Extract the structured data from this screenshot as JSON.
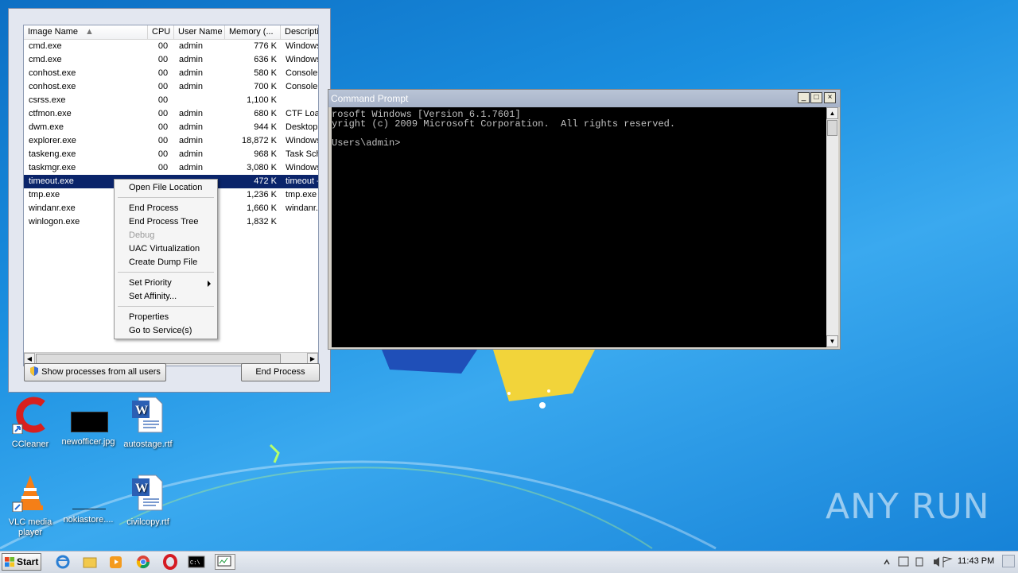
{
  "colors": {
    "selection": "#0a246a",
    "desktop": "#1a8fe0",
    "console_bg": "#000000",
    "console_fg": "#c0c0c0"
  },
  "taskmgr": {
    "columns": [
      "Image Name",
      "CPU",
      "User Name",
      "Memory (...",
      "Descripti"
    ],
    "processes": [
      {
        "name": "cmd.exe",
        "cpu": "00",
        "user": "admin",
        "mem": "776 K",
        "desc": "Windows"
      },
      {
        "name": "cmd.exe",
        "cpu": "00",
        "user": "admin",
        "mem": "636 K",
        "desc": "Windows"
      },
      {
        "name": "conhost.exe",
        "cpu": "00",
        "user": "admin",
        "mem": "580 K",
        "desc": "Console"
      },
      {
        "name": "conhost.exe",
        "cpu": "00",
        "user": "admin",
        "mem": "700 K",
        "desc": "Console"
      },
      {
        "name": "csrss.exe",
        "cpu": "00",
        "user": "",
        "mem": "1,100 K",
        "desc": ""
      },
      {
        "name": "ctfmon.exe",
        "cpu": "00",
        "user": "admin",
        "mem": "680 K",
        "desc": "CTF Loac"
      },
      {
        "name": "dwm.exe",
        "cpu": "00",
        "user": "admin",
        "mem": "944 K",
        "desc": "Desktop"
      },
      {
        "name": "explorer.exe",
        "cpu": "00",
        "user": "admin",
        "mem": "18,872 K",
        "desc": "Windows"
      },
      {
        "name": "taskeng.exe",
        "cpu": "00",
        "user": "admin",
        "mem": "968 K",
        "desc": "Task Sch"
      },
      {
        "name": "taskmgr.exe",
        "cpu": "00",
        "user": "admin",
        "mem": "3,080 K",
        "desc": "Windows"
      },
      {
        "name": "timeout.exe",
        "cpu": "",
        "user": "",
        "mem": "472 K",
        "desc": "timeout -"
      },
      {
        "name": "tmp.exe",
        "cpu": "",
        "user": "",
        "mem": "1,236 K",
        "desc": "tmp.exe"
      },
      {
        "name": "windanr.exe",
        "cpu": "",
        "user": "",
        "mem": "1,660 K",
        "desc": "windanr."
      },
      {
        "name": "winlogon.exe",
        "cpu": "",
        "user": "",
        "mem": "1,832 K",
        "desc": ""
      }
    ],
    "selected_process": "timeout.exe",
    "show_all_label": "Show processes from all users",
    "end_process_label": "End Process"
  },
  "context_menu": {
    "items": [
      {
        "label": "Open File Location",
        "disabled": false
      },
      {
        "label": "End Process",
        "disabled": false
      },
      {
        "label": "End Process Tree",
        "disabled": false
      },
      {
        "label": "Debug",
        "disabled": true
      },
      {
        "label": "UAC Virtualization",
        "disabled": false
      },
      {
        "label": "Create Dump File",
        "disabled": false
      },
      {
        "label": "Set Priority",
        "disabled": false,
        "submenu": true
      },
      {
        "label": "Set Affinity...",
        "disabled": false
      },
      {
        "label": "Properties",
        "disabled": false
      },
      {
        "label": "Go to Service(s)",
        "disabled": false
      }
    ]
  },
  "cmd": {
    "title": "Command Prompt",
    "lines": [
      "rosoft Windows [Version 6.1.7601]",
      "yright (c) 2009 Microsoft Corporation.  All rights reserved.",
      "",
      "Users\\admin>"
    ],
    "buttons": [
      "_",
      "□",
      "×"
    ]
  },
  "desktop_icons": [
    {
      "label": "CCleaner",
      "icon": "ccleaner-icon"
    },
    {
      "label": "newofficer.jpg",
      "icon": "image-file-icon"
    },
    {
      "label": "autostage.rtf",
      "icon": "word-document-icon"
    },
    {
      "label": "VLC media player",
      "icon": "vlc-icon"
    },
    {
      "label": "nokiastore....",
      "icon": "image-file-icon"
    },
    {
      "label": "civilcopy.rtf",
      "icon": "word-document-icon"
    }
  ],
  "watermark": "ANY RUN",
  "taskbar": {
    "start_label": "Start",
    "clock": "11:43 PM",
    "pinned": [
      "ie-icon",
      "explorer-folder-icon",
      "media-player-icon",
      "chrome-icon",
      "opera-icon",
      "cmd-icon",
      "taskmgr-icon"
    ]
  }
}
